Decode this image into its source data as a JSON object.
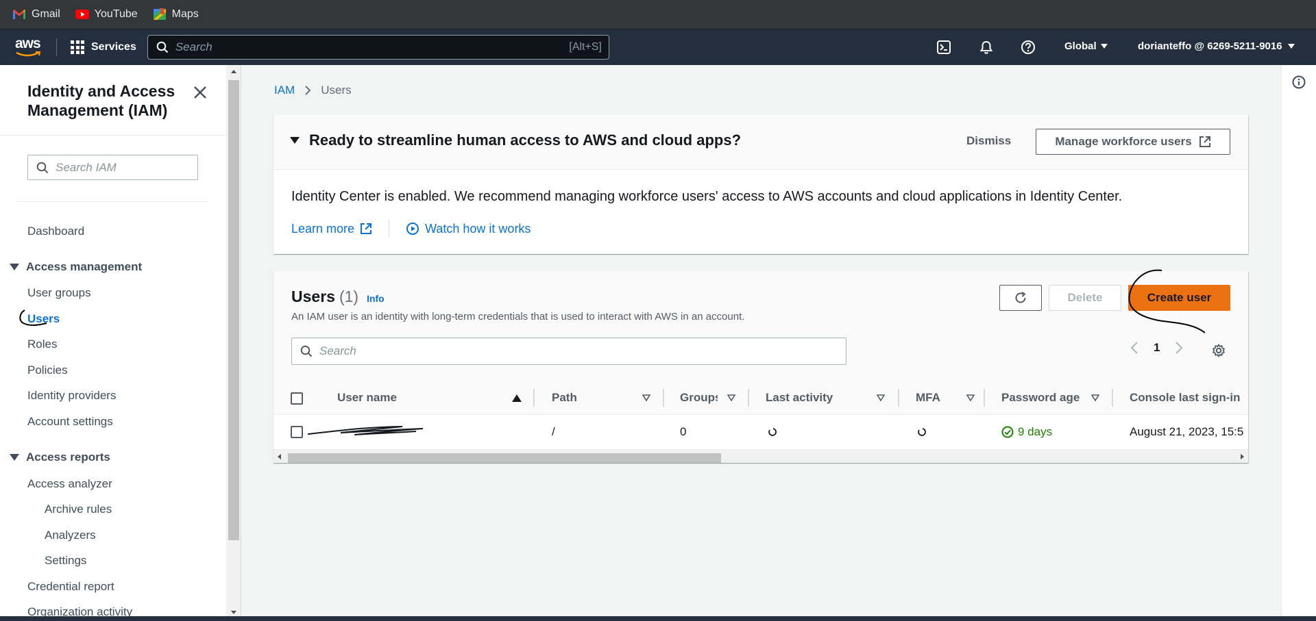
{
  "bookmarks": [
    {
      "label": "Gmail",
      "icon": "gmail-icon"
    },
    {
      "label": "YouTube",
      "icon": "youtube-icon"
    },
    {
      "label": "Maps",
      "icon": "maps-icon"
    }
  ],
  "topnav": {
    "logo_text": "aws",
    "services_label": "Services",
    "search_placeholder": "Search",
    "search_shortcut": "[Alt+S]",
    "region": "Global",
    "account": "dorianteffo @ 6269-5211-9016"
  },
  "sidebar": {
    "title": "Identity and Access Management (IAM)",
    "search_placeholder": "Search IAM",
    "dashboard": "Dashboard",
    "sections": [
      {
        "label": "Access management",
        "items": [
          "User groups",
          "Users",
          "Roles",
          "Policies",
          "Identity providers",
          "Account settings"
        ],
        "active": "Users"
      },
      {
        "label": "Access reports",
        "items": [
          "Access analyzer",
          "Archive rules",
          "Analyzers",
          "Settings",
          "Credential report",
          "Organization activity"
        ]
      }
    ]
  },
  "breadcrumb": {
    "root": "IAM",
    "current": "Users"
  },
  "banner": {
    "title": "Ready to streamline human access to AWS and cloud apps?",
    "dismiss_label": "Dismiss",
    "manage_label": "Manage workforce users",
    "body": "Identity Center is enabled. We recommend managing workforce users' access to AWS accounts and cloud applications in Identity Center.",
    "learn_more": "Learn more",
    "watch": "Watch how it works"
  },
  "users_panel": {
    "title": "Users",
    "count": "(1)",
    "info": "Info",
    "description": "An IAM user is an identity with long-term credentials that is used to interact with AWS in an account.",
    "delete_label": "Delete",
    "create_label": "Create user",
    "search_placeholder": "Search",
    "page": "1",
    "columns": [
      "User name",
      "Path",
      "Groups",
      "Last activity",
      "MFA",
      "Password age",
      "Console last sign-in"
    ],
    "rows": [
      {
        "user_name": "",
        "path": "/",
        "groups": "0",
        "last_activity": "",
        "mfa": "",
        "password_age": "9 days",
        "console_last_sign_in": "August 21, 2023, 15:5"
      }
    ]
  },
  "colors": {
    "nav_bg": "#232f3e",
    "primary": "#ec7211",
    "link": "#0972d3",
    "success": "#1d8102"
  }
}
